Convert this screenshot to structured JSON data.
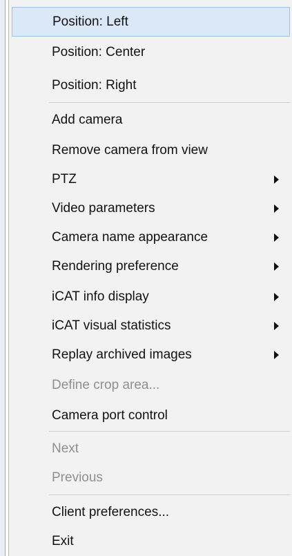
{
  "menu": {
    "items": [
      {
        "label": "Position: Left"
      },
      {
        "label": "Position: Center"
      },
      {
        "label": "Position: Right"
      },
      {
        "label": "Add camera"
      },
      {
        "label": "Remove camera from view"
      },
      {
        "label": "PTZ"
      },
      {
        "label": "Video parameters"
      },
      {
        "label": "Camera name appearance"
      },
      {
        "label": "Rendering preference"
      },
      {
        "label": "iCAT info display"
      },
      {
        "label": "iCAT visual statistics"
      },
      {
        "label": "Replay archived images"
      },
      {
        "label": "Define crop area..."
      },
      {
        "label": "Camera port control"
      },
      {
        "label": "Next"
      },
      {
        "label": "Previous"
      },
      {
        "label": "Client preferences..."
      },
      {
        "label": "Exit"
      }
    ]
  }
}
